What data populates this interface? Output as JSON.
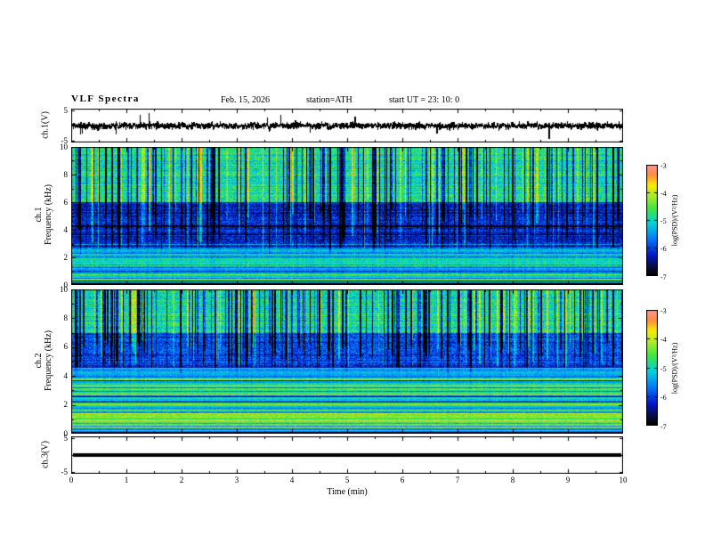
{
  "header": {
    "title": "VLF Spectra",
    "date": "Feb. 15, 2026",
    "station": "station=ATH",
    "start_ut": "start UT =  23: 10: 0"
  },
  "xaxis": {
    "label": "Time (min)",
    "range": [
      0,
      10
    ],
    "ticks": [
      0,
      1,
      2,
      3,
      4,
      5,
      6,
      7,
      8,
      9,
      10
    ]
  },
  "colorbar": {
    "label": "log(PSD)/(V²/Hz)",
    "ticks": [
      -3,
      -4,
      -5,
      -6,
      -7
    ],
    "range": [
      -7,
      -3
    ],
    "colormap": [
      {
        "t": 0.0,
        "c": "#000000"
      },
      {
        "t": 0.06,
        "c": "#0a0a28"
      },
      {
        "t": 0.18,
        "c": "#0014c8"
      },
      {
        "t": 0.33,
        "c": "#0078ff"
      },
      {
        "t": 0.47,
        "c": "#00d2dc"
      },
      {
        "t": 0.6,
        "c": "#3ce646"
      },
      {
        "t": 0.72,
        "c": "#aaeb28"
      },
      {
        "t": 0.82,
        "c": "#faeb00"
      },
      {
        "t": 0.91,
        "c": "#ff8c3c"
      },
      {
        "t": 1.0,
        "c": "#ff9696"
      }
    ]
  },
  "chart_data": [
    {
      "type": "line",
      "id": "ch1_wave",
      "ylabel": "ch.1(V)",
      "ylim": [
        -5,
        5
      ],
      "yticks": [
        5,
        -5
      ],
      "xlim": [
        0,
        10
      ],
      "color": "#000000",
      "seed": 11,
      "noise_std": 0.5,
      "spike_prob": 0.007,
      "spike_amp": [
        2.0,
        4.8
      ],
      "spike_neg_frac": 0.6,
      "description": "broadband noise around 0 V with impulsive sferic spikes"
    },
    {
      "type": "heatmap",
      "id": "ch1_spec",
      "ylabel_line1": "ch.1",
      "ylabel_line2": "Frequency (kHz)",
      "ylim": [
        0,
        10
      ],
      "yticks": [
        0,
        2,
        4,
        6,
        8,
        10
      ],
      "xlim": [
        0,
        10
      ],
      "value_range": [
        -7,
        -3
      ],
      "seed": 101,
      "bands": [
        {
          "fmin": 6.0,
          "fmax": 10.01,
          "base": -4.9,
          "rowvar": 0.25,
          "pix": 0.5,
          "streak": 1.0
        },
        {
          "fmin": 2.7,
          "fmax": 6.0,
          "base": -6.2,
          "rowvar": 0.22,
          "pix": 0.45,
          "streak": 0.85
        },
        {
          "fmin": 0.45,
          "fmax": 2.7,
          "base": -5.3,
          "rowvar": 0.5,
          "pix": 0.3,
          "streak": 0.3
        },
        {
          "fmin": 0.0,
          "fmax": 0.45,
          "base": -5.3,
          "rowvar": 1.3,
          "pix": 0.15,
          "streak": 0.1
        }
      ],
      "row_lines": {
        "fmax": 2.7,
        "p_bright": 0.05,
        "bright": [
          0.4,
          0.8
        ],
        "p_dark": 0.08,
        "dark": [
          0.5,
          1.0
        ]
      },
      "lines": [
        {
          "f": 4.35,
          "dv": -0.8,
          "w": 2
        },
        {
          "f": 3.7,
          "dv": -0.7,
          "w": 1
        },
        {
          "f": 5.2,
          "dv": -0.5,
          "w": 1
        },
        {
          "f": 2.95,
          "dv": 0.7,
          "w": 1
        },
        {
          "f": 1.6,
          "dv": 0.5,
          "w": 1
        },
        {
          "f": 0.75,
          "dv": 0.8,
          "w": 1
        },
        {
          "f": 0.3,
          "dv": -1.5,
          "w": 1
        },
        {
          "f": 0.12,
          "dv": -1.7,
          "w": 2
        }
      ],
      "streaks": {
        "p_dark": 0.2,
        "p_bright": 0.1,
        "dark_amp": [
          0.9,
          2.5
        ],
        "bright_amp": [
          0.5,
          1.3
        ],
        "bottom_range": [
          2.2,
          5.5
        ]
      }
    },
    {
      "type": "heatmap",
      "id": "ch2_spec",
      "ylabel_line1": "ch.2",
      "ylabel_line2": "Frequency (kHz)",
      "ylim": [
        0,
        10
      ],
      "yticks": [
        0,
        2,
        4,
        6,
        8,
        10
      ],
      "xlim": [
        0,
        10
      ],
      "value_range": [
        -7,
        -3
      ],
      "seed": 202,
      "bands": [
        {
          "fmin": 7.0,
          "fmax": 10.01,
          "base": -4.95,
          "rowvar": 0.25,
          "pix": 0.5,
          "streak": 1.0
        },
        {
          "fmin": 4.6,
          "fmax": 7.0,
          "base": -6.0,
          "rowvar": 0.25,
          "pix": 0.45,
          "streak": 0.85
        },
        {
          "fmin": 2.2,
          "fmax": 4.6,
          "base": -5.1,
          "rowvar": 0.7,
          "pix": 0.25,
          "streak": 0.25
        },
        {
          "fmin": 0.35,
          "fmax": 2.2,
          "base": -4.85,
          "rowvar": 0.75,
          "pix": 0.25,
          "streak": 0.12
        },
        {
          "fmin": 0.0,
          "fmax": 0.35,
          "base": -5.2,
          "rowvar": 1.4,
          "pix": 0.15,
          "streak": 0.08
        }
      ],
      "row_lines": {
        "fmax": 4.6,
        "p_bright": 0.1,
        "bright": [
          0.7,
          1.5
        ],
        "p_dark": 0.1,
        "dark": [
          0.6,
          1.2
        ]
      },
      "lines": [
        {
          "f": 3.35,
          "dv": 1.45,
          "w": 1
        },
        {
          "f": 2.05,
          "dv": 1.0,
          "w": 1
        },
        {
          "f": 0.95,
          "dv": 1.1,
          "w": 1
        },
        {
          "f": 1.4,
          "dv": 0.7,
          "w": 1
        },
        {
          "f": 2.6,
          "dv": -0.9,
          "w": 1
        },
        {
          "f": 4.0,
          "dv": -0.7,
          "w": 1
        },
        {
          "f": 0.5,
          "dv": 0.9,
          "w": 1
        },
        {
          "f": 0.15,
          "dv": -1.8,
          "w": 2
        }
      ],
      "streaks": {
        "p_dark": 0.22,
        "p_bright": 0.08,
        "dark_amp": [
          0.9,
          2.4
        ],
        "bright_amp": [
          0.5,
          1.2
        ],
        "bottom_range": [
          4.2,
          6.5
        ]
      }
    },
    {
      "type": "line",
      "id": "ch3_flat",
      "ylabel": "ch.3(V)",
      "ylim": [
        -5,
        5
      ],
      "yticks": [
        5,
        -5
      ],
      "xlim": [
        0,
        10
      ],
      "value": 0,
      "linewidth": 4,
      "color": "#000000",
      "description": "flat line at 0 V (no signal on channel 3)"
    }
  ]
}
